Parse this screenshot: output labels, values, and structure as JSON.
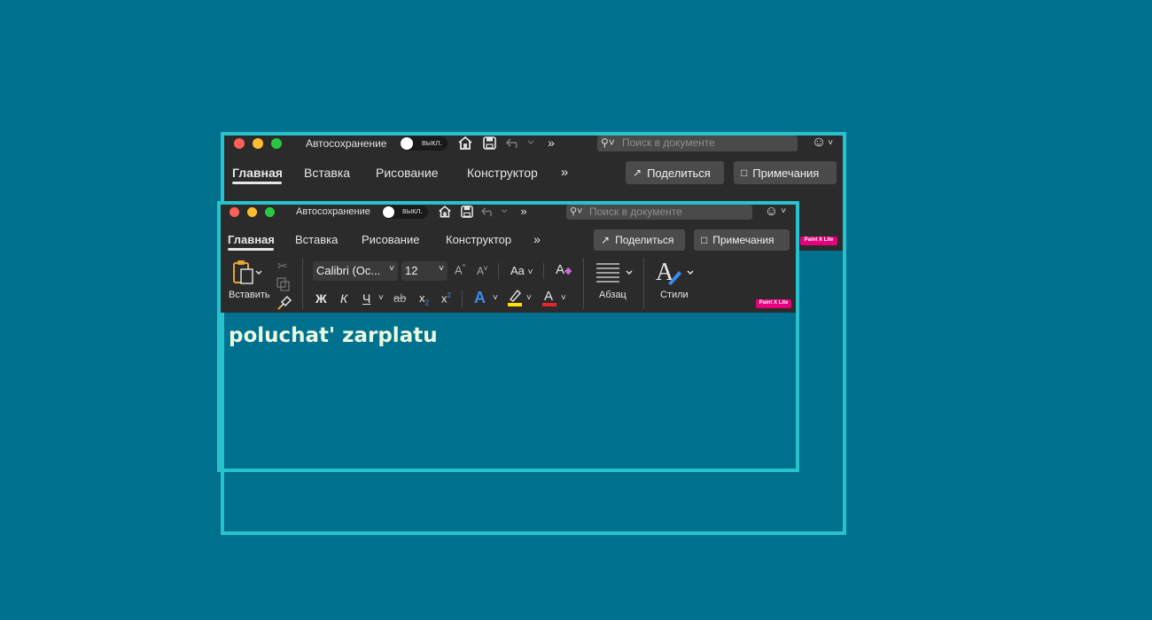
{
  "colors": {
    "background": "#00708f",
    "frame": "#28c2cc",
    "window": "#2b2b2b",
    "badge": "#e6007a",
    "doc_text": "#e9f8df"
  },
  "back_window": {
    "autosave_label": "Автосохранение",
    "toggle_label": "выкл.",
    "search_placeholder": "Поиск в документе",
    "tabs": [
      "Главная",
      "Вставка",
      "Рисование",
      "Конструктор"
    ],
    "share_label": "Поделиться",
    "comments_label": "Примечания",
    "badge": "Paint X Lite"
  },
  "front_window": {
    "autosave_label": "Автосохранение",
    "toggle_label": "выкл.",
    "search_placeholder": "Поиск в документе",
    "tabs": [
      "Главная",
      "Вставка",
      "Рисование",
      "Конструктор"
    ],
    "share_label": "Поделиться",
    "comments_label": "Примечания",
    "paste_label": "Вставить",
    "font_name": "Calibri (Ос...",
    "font_size": "12",
    "paragraph_label": "Абзац",
    "styles_label": "Стили",
    "bold_glyph": "Ж",
    "italic_glyph": "К",
    "underline_glyph": "Ч",
    "strike_glyph": "ab",
    "sub_glyph": "x",
    "sup_glyph": "x",
    "badge": "Paint X Lite"
  },
  "icons": [
    "home-icon",
    "save-icon",
    "undo-icon",
    "more-icon",
    "search-icon",
    "smiley-icon",
    "share-icon",
    "comment-icon",
    "paste-icon",
    "cut-icon",
    "copy-icon",
    "format-painter-icon",
    "grow-font-icon",
    "shrink-font-icon",
    "change-case-icon",
    "clear-format-icon",
    "text-effects-icon",
    "highlight-icon",
    "font-color-icon",
    "paragraph-icon",
    "styles-icon"
  ],
  "document": {
    "text": "poluchat' zarplatu"
  }
}
